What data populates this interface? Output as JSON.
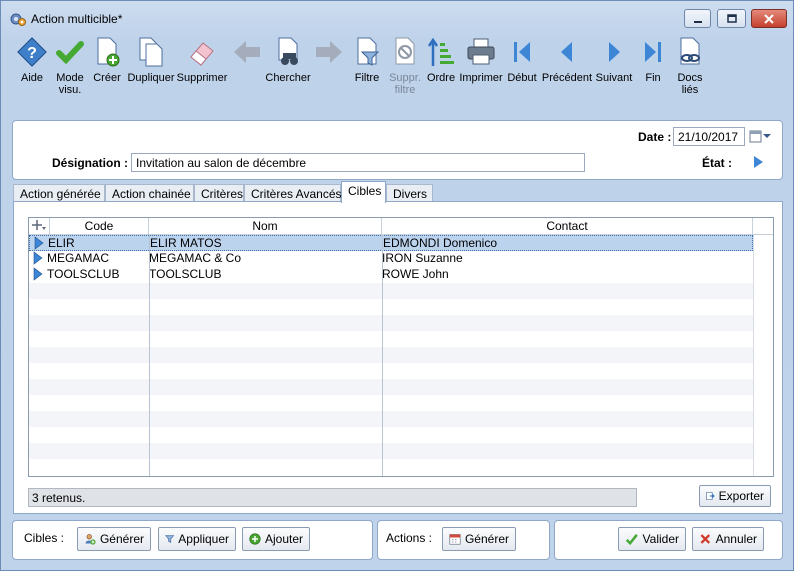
{
  "window": {
    "title": "Action multicible*"
  },
  "toolbar": {
    "items": [
      {
        "label": "Aide",
        "icon": "help-icon"
      },
      {
        "label": "Mode\nvisu.",
        "icon": "check-icon"
      },
      {
        "label": "Créer",
        "icon": "new-document-icon"
      },
      {
        "label": "Dupliquer",
        "icon": "duplicate-icon"
      },
      {
        "label": "Supprimer",
        "icon": "eraser-icon"
      },
      {
        "label": "",
        "icon": "arrow-left-icon"
      },
      {
        "label": "Chercher",
        "icon": "binoculars-icon"
      },
      {
        "label": "",
        "icon": "arrow-right-icon"
      },
      {
        "label": "Filtre",
        "icon": "filter-icon"
      },
      {
        "label": "Suppr.\nfiltre",
        "icon": "remove-filter-icon"
      },
      {
        "label": "Ordre",
        "icon": "sort-order-icon"
      },
      {
        "label": "Imprimer",
        "icon": "printer-icon"
      },
      {
        "label": "Début",
        "icon": "first-icon"
      },
      {
        "label": "Précédent",
        "icon": "previous-icon"
      },
      {
        "label": "Suivant",
        "icon": "next-icon"
      },
      {
        "label": "Fin",
        "icon": "last-icon"
      },
      {
        "label": "Docs\nliés",
        "icon": "linked-docs-icon"
      }
    ]
  },
  "header": {
    "date_label": "Date :",
    "date_value": "21/10/2017",
    "designation_label": "Désignation :",
    "designation_value": "Invitation au salon de décembre",
    "etat_label": "État :"
  },
  "tabs": [
    {
      "label": "Action générée"
    },
    {
      "label": "Action chainée"
    },
    {
      "label": "Critères"
    },
    {
      "label": "Critères Avancés"
    },
    {
      "label": "Cibles"
    },
    {
      "label": "Divers"
    }
  ],
  "grid": {
    "columns": [
      "Code",
      "Nom",
      "Contact"
    ],
    "rows": [
      {
        "code": "ELIR",
        "nom": "ELIR MATOS",
        "contact": "EDMONDI Domenico"
      },
      {
        "code": "MEGAMAC",
        "nom": "MEGAMAC & Co",
        "contact": "IRON Suzanne"
      },
      {
        "code": "TOOLSCLUB",
        "nom": "TOOLSCLUB",
        "contact": "ROWE John"
      }
    ]
  },
  "status_text": "3 retenus.",
  "export_label": "Exporter",
  "bottom": {
    "cibles_label": "Cibles :",
    "generer_label": "Générer",
    "appliquer_label": "Appliquer",
    "ajouter_label": "Ajouter",
    "actions_label": "Actions :",
    "actions_generer_label": "Générer",
    "valider_label": "Valider",
    "annuler_label": "Annuler"
  },
  "colors": {
    "accent": "#3f7fc9",
    "selection": "#bcd3ee",
    "check_green": "#46a934",
    "cancel_red": "#d23a2a"
  }
}
